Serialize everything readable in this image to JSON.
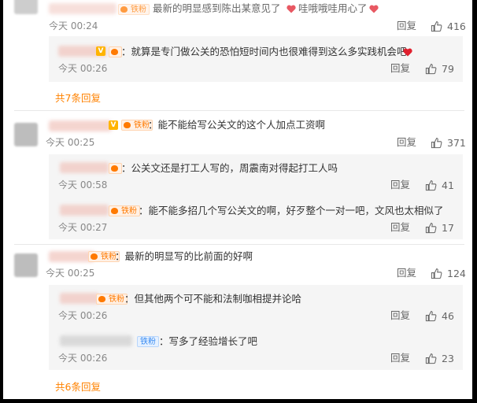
{
  "colors": {
    "accent": "#ff8200",
    "badge_orange": "#ff7a00",
    "badge_blue": "#3a8cf2",
    "heart": "#e0202e"
  },
  "common": {
    "reply_label": "回复"
  },
  "top_comment": {
    "badge": "铁粉",
    "text": "最新的明显感到陈出某意见了",
    "text2": "哇哦哦哇用心了",
    "time": "今天 00:24",
    "likes": "416",
    "replies": [
      {
        "badge": "铁粉",
        "text": "：就算是专门做公关的恐怕短时间内也很难得到这么多实践机会吧",
        "time": "今天 00:26",
        "likes": "79"
      }
    ],
    "more": "共7条回复"
  },
  "comment2": {
    "badge": "铁粉",
    "text": "：能不能给写公关文的这个人加点工资啊",
    "time": "今天 00:25",
    "likes": "371",
    "replies": [
      {
        "badge": "铁粉",
        "text": "：公关文还是打工人写的，周震南对得起打工人吗",
        "time": "今天 00:58",
        "likes": "41"
      },
      {
        "badge": "铁粉",
        "text": "：能不能多招几个写公关文的啊，好歹整个一对一吧，文风也太相似了",
        "time": "今天 00:27",
        "likes": "17"
      }
    ]
  },
  "comment3": {
    "badge": "铁粉",
    "text": "：最新的明显写的比前面的好啊",
    "time": "今天 00:25",
    "likes": "124",
    "replies": [
      {
        "badge": "铁粉",
        "text": "：但其他两个可不能和法制咖相提并论哈",
        "time": "今天 00:26",
        "likes": "46"
      },
      {
        "badge": "铁粉",
        "text": "：写多了经验增长了吧",
        "time": "今天 00:26",
        "likes": "23"
      }
    ],
    "more": "共6条回复"
  },
  "icons": {
    "like": "thumbs-up-icon",
    "heart": "red-heart-icon",
    "fan": "fan-heart-icon",
    "vip": "v-badge-icon"
  }
}
